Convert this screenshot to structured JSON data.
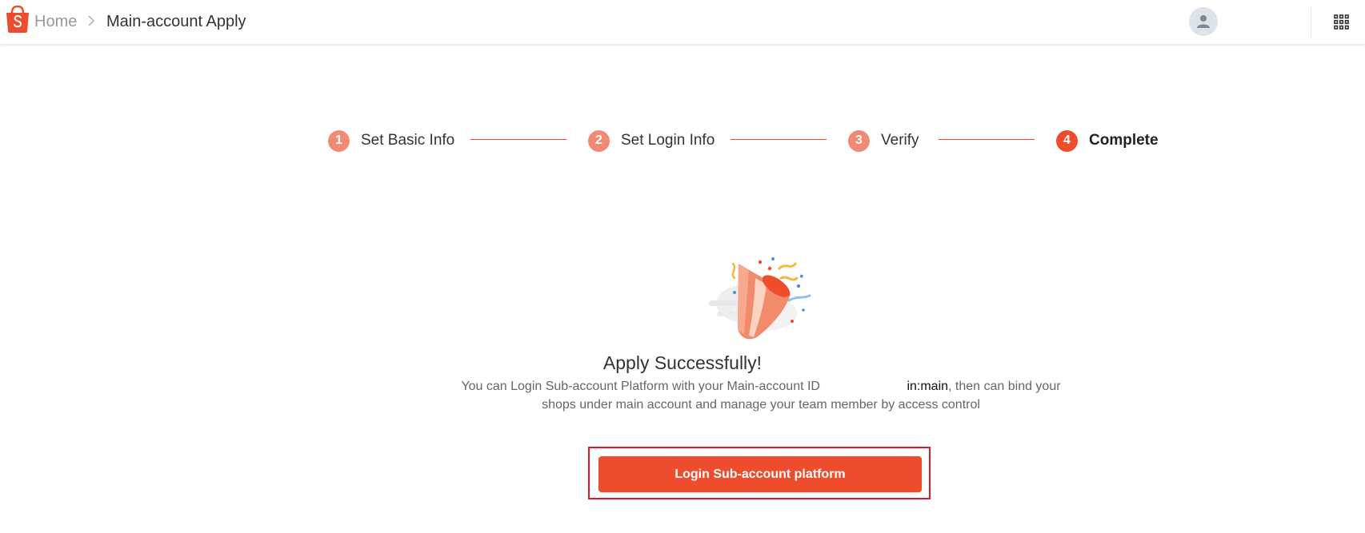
{
  "colors": {
    "brand": "#ee4d2d",
    "step_done": "#f08a74",
    "highlight_frame": "#e0162b"
  },
  "header": {
    "logo_icon": "shopee-bag-icon",
    "breadcrumb": {
      "home": "Home",
      "separator_icon": "chevron-right-icon",
      "current": "Main-account Apply"
    },
    "avatar_icon": "user-avatar-icon",
    "apps_icon": "apps-grid-icon"
  },
  "stepper": {
    "steps": [
      {
        "number": "1",
        "label": "Set Basic Info",
        "state": "done"
      },
      {
        "number": "2",
        "label": "Set Login Info",
        "state": "done"
      },
      {
        "number": "3",
        "label": "Verify",
        "state": "done"
      },
      {
        "number": "4",
        "label": "Complete",
        "state": "active"
      }
    ]
  },
  "result": {
    "illustration_icon": "party-popper-icon",
    "title": "Apply Successfully!",
    "desc_before": "You can Login Sub-account Platform with your Main-account ID",
    "main_account_id": "in:main",
    "desc_after": ", then can bind your shops under main account and manage your team member by access control"
  },
  "actions": {
    "login_button": "Login Sub-account platform"
  }
}
